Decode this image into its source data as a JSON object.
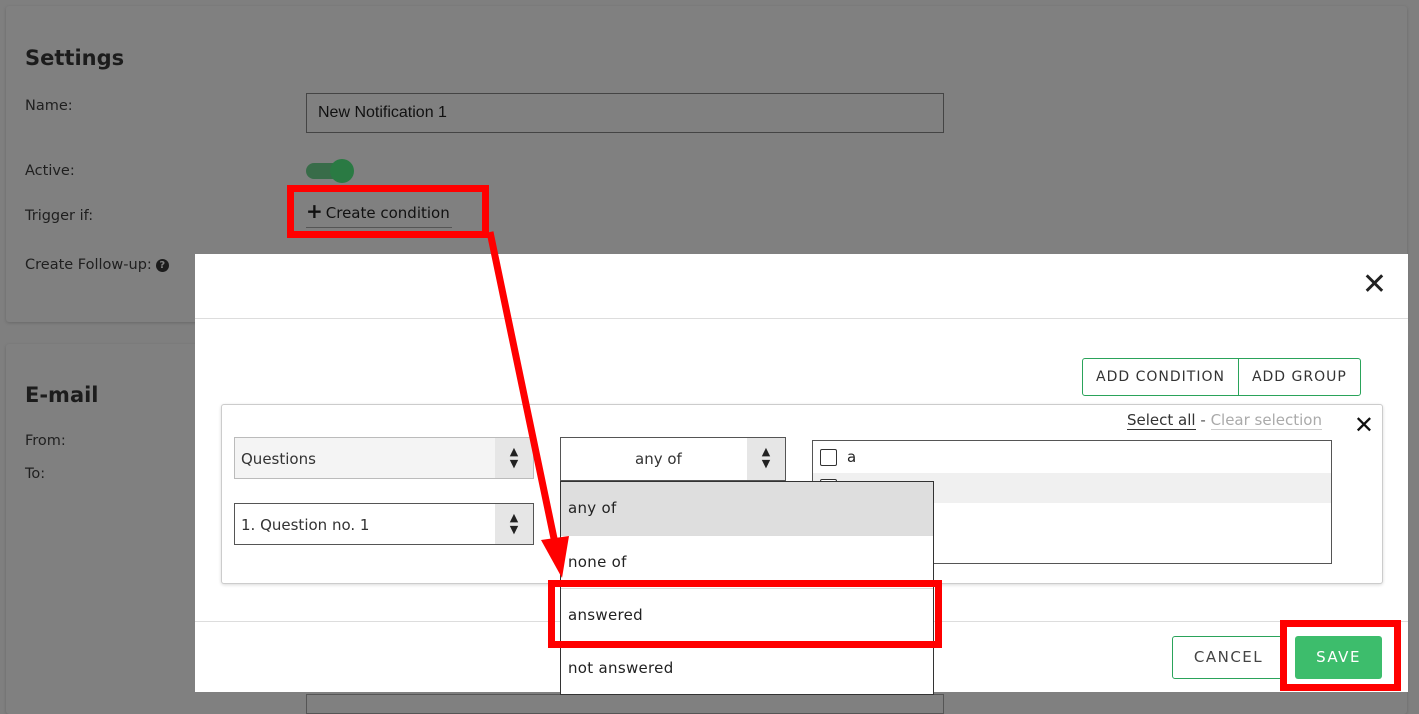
{
  "settings": {
    "title": "Settings",
    "name_label": "Name:",
    "name_value": "New Notification 1",
    "active_label": "Active:",
    "active": true,
    "trigger_label": "Trigger if:",
    "create_condition": "Create condition",
    "followup_label": "Create Follow-up:",
    "help_icon": "question-circle-icon"
  },
  "email": {
    "title": "E-mail",
    "from_label": "From:",
    "to_label": "To:"
  },
  "modal": {
    "close_icon": "close-icon",
    "add_condition": "ADD CONDITION",
    "add_group": "ADD GROUP",
    "condition": {
      "source_select": "Questions",
      "question_select": "1. Question no. 1",
      "operator_select": "any of",
      "select_all": "Select all",
      "separator": "-",
      "clear_selection": "Clear selection",
      "answers": [
        {
          "label": "a",
          "checked": false
        },
        {
          "label": "",
          "checked": false
        }
      ]
    },
    "operator_options": [
      "any of",
      "none of",
      "answered",
      "not answered"
    ],
    "cancel": "CANCEL",
    "save": "SAVE"
  },
  "annotations": {
    "highlight_color": "#ff0000",
    "accent_color": "#3dbd6c"
  }
}
